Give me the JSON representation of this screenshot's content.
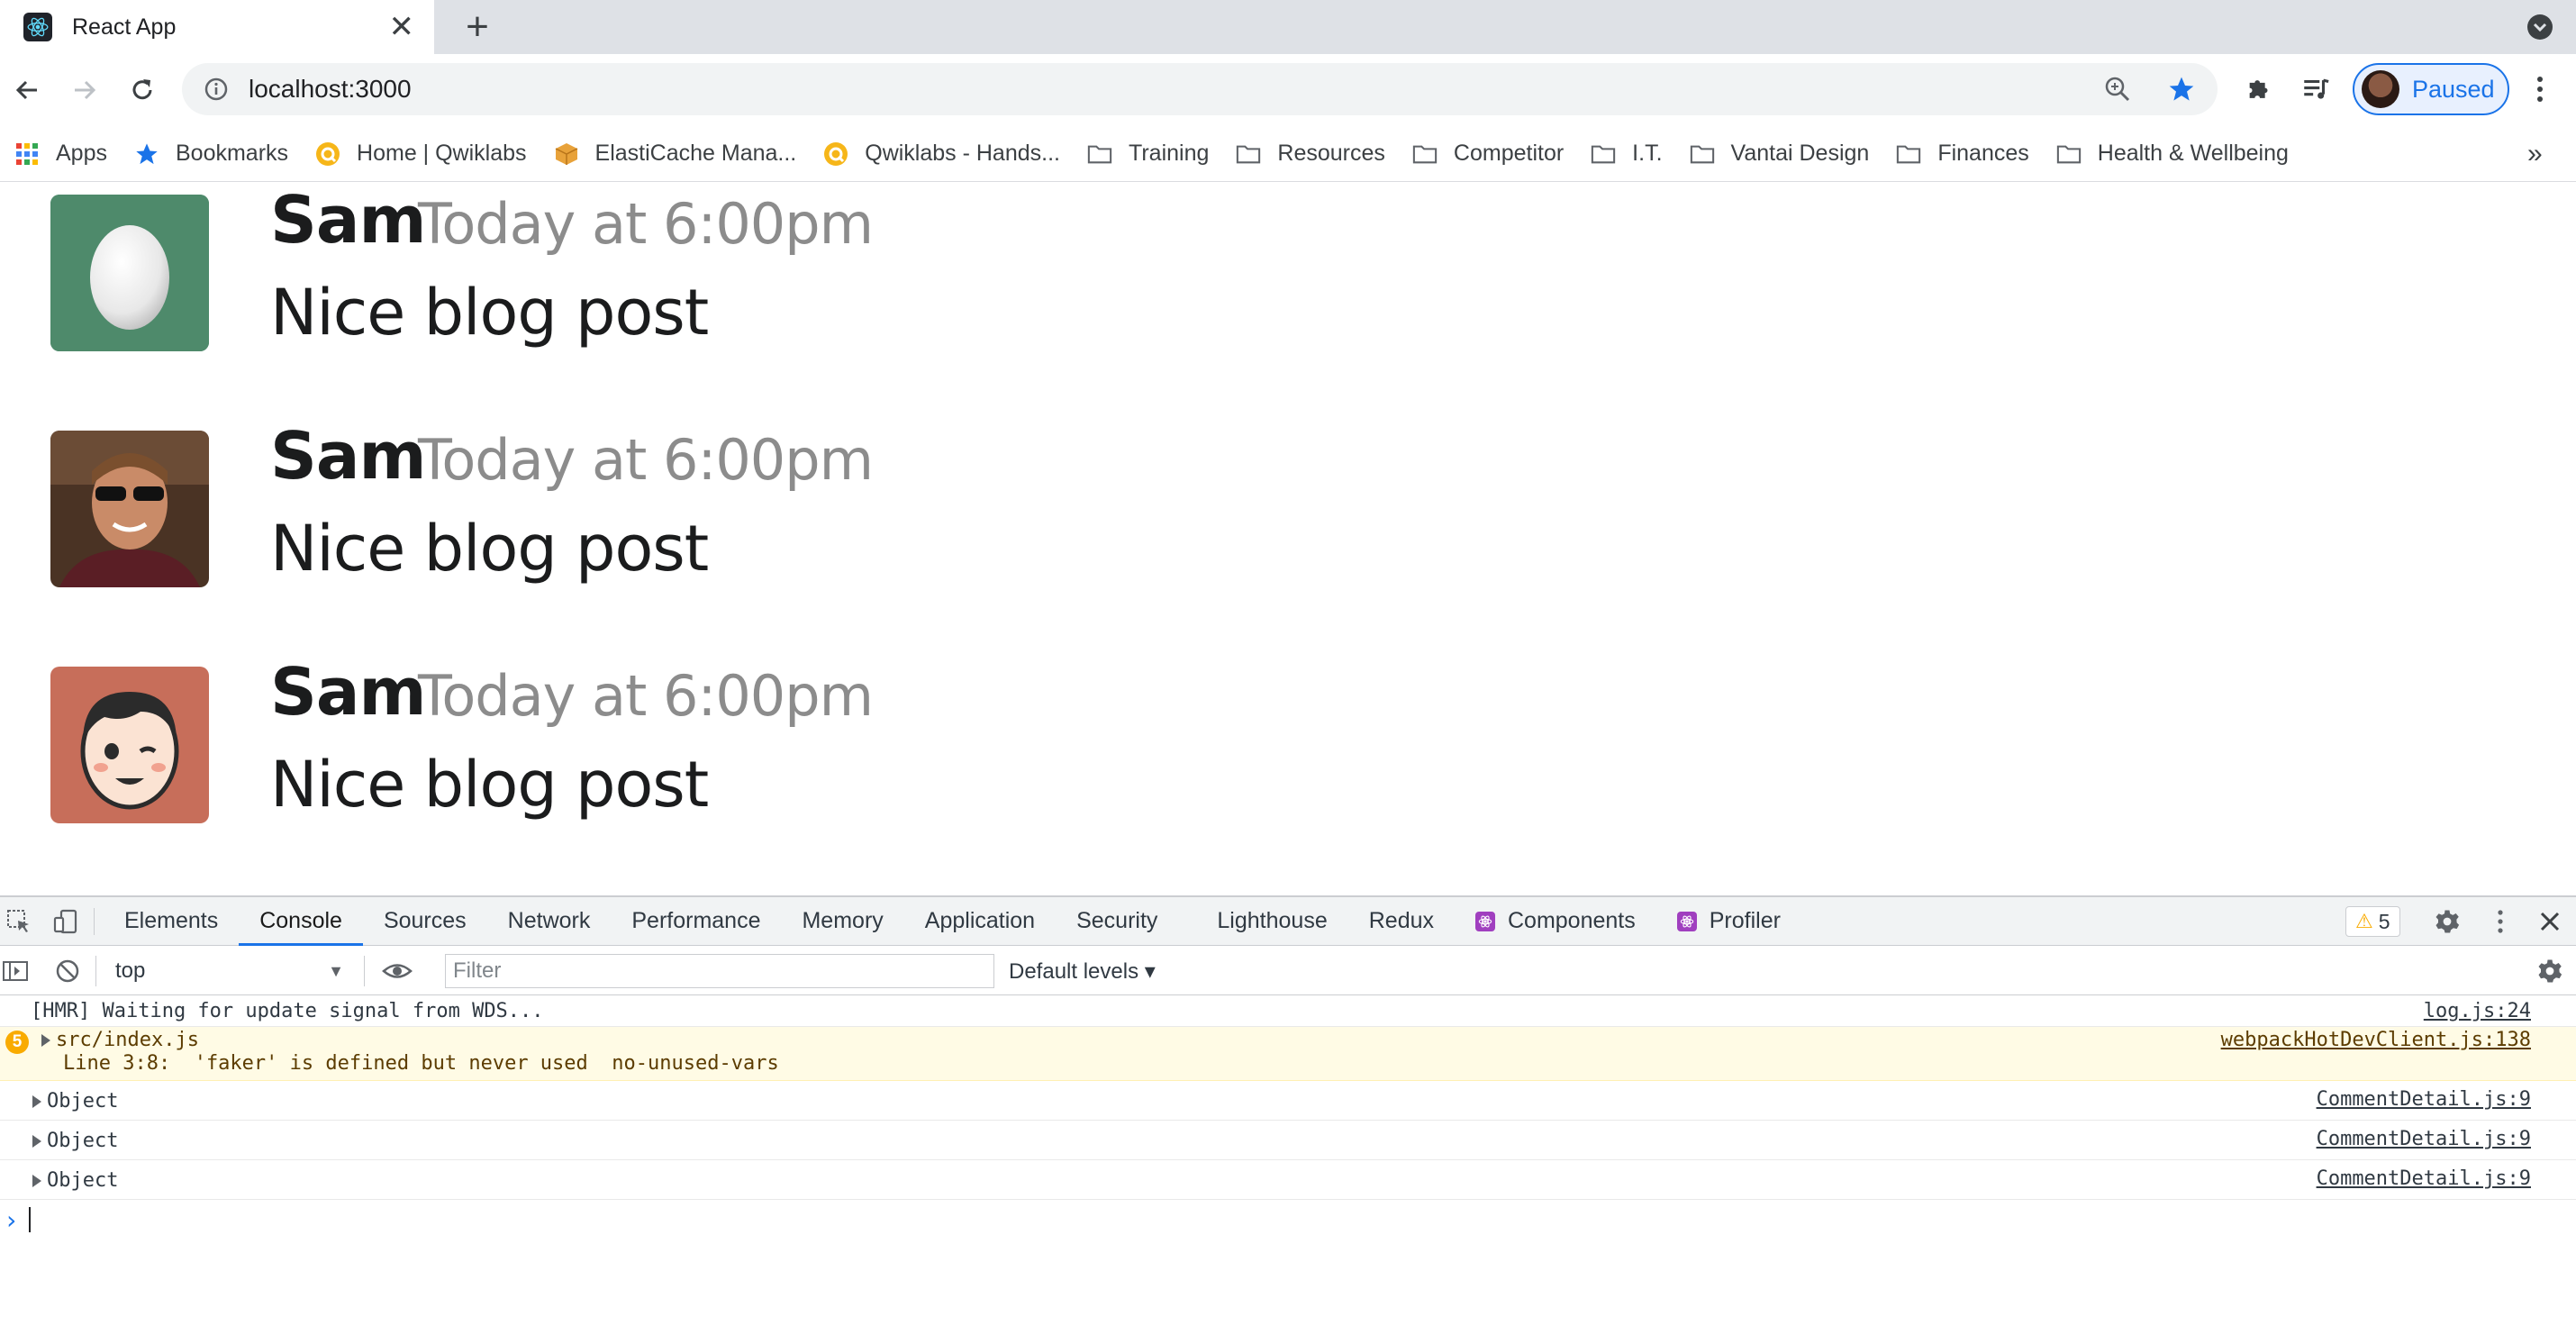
{
  "browser": {
    "tab": {
      "title": "React App",
      "close": "✕"
    },
    "new_tab": "+",
    "address": {
      "url": "localhost:3000"
    },
    "profile": {
      "label": "Paused"
    },
    "bookmarks": [
      {
        "label": "Apps",
        "icon": "apps-grid-icon"
      },
      {
        "label": "Bookmarks",
        "icon": "star-icon"
      },
      {
        "label": "Home | Qwiklabs",
        "icon": "qwiklabs-icon"
      },
      {
        "label": "ElastiCache Mana...",
        "icon": "aws-box-icon"
      },
      {
        "label": "Qwiklabs - Hands...",
        "icon": "qwiklabs-icon"
      },
      {
        "label": "Training",
        "icon": "folder-icon"
      },
      {
        "label": "Resources",
        "icon": "folder-icon"
      },
      {
        "label": "Competitor",
        "icon": "folder-icon"
      },
      {
        "label": "I.T.",
        "icon": "folder-icon"
      },
      {
        "label": "Vantai Design",
        "icon": "folder-icon"
      },
      {
        "label": "Finances",
        "icon": "folder-icon"
      },
      {
        "label": "Health & Wellbeing",
        "icon": "folder-icon"
      }
    ],
    "bookmarks_more": "»"
  },
  "comments": [
    {
      "author": "Sam",
      "date": "Today at 6:00pm",
      "text": "Nice blog post",
      "avatar": "egg-avatar",
      "avatar_color": "#4e8a6b"
    },
    {
      "author": "Sam",
      "date": "Today at 6:00pm",
      "text": "Nice blog post",
      "avatar": "photo-avatar",
      "avatar_color": "#3a2a20"
    },
    {
      "author": "Sam",
      "date": "Today at 6:00pm",
      "text": "Nice blog post",
      "avatar": "cartoon-face-avatar",
      "avatar_color": "#c76e5a"
    }
  ],
  "devtools": {
    "tabs": [
      "Elements",
      "Console",
      "Sources",
      "Network",
      "Performance",
      "Memory",
      "Application",
      "Security",
      "Lighthouse",
      "Redux",
      "Components",
      "Profiler"
    ],
    "active_tab": "Console",
    "warnings_count": "5",
    "context": "top",
    "filter_placeholder": "Filter",
    "levels": "Default levels ▾",
    "messages": [
      {
        "text": "[HMR] Waiting for update signal from WDS...",
        "source": "log.js:24"
      },
      {
        "badge": "5",
        "text": "src/index.js",
        "detail": "Line 3:8:  'faker' is defined but never used  no-unused-vars",
        "source": "webpackHotDevClient.js:138"
      },
      {
        "text": "Object",
        "source": "CommentDetail.js:9"
      },
      {
        "text": "Object",
        "source": "CommentDetail.js:9"
      },
      {
        "text": "Object",
        "source": "CommentDetail.js:9"
      }
    ],
    "prompt": "›"
  }
}
